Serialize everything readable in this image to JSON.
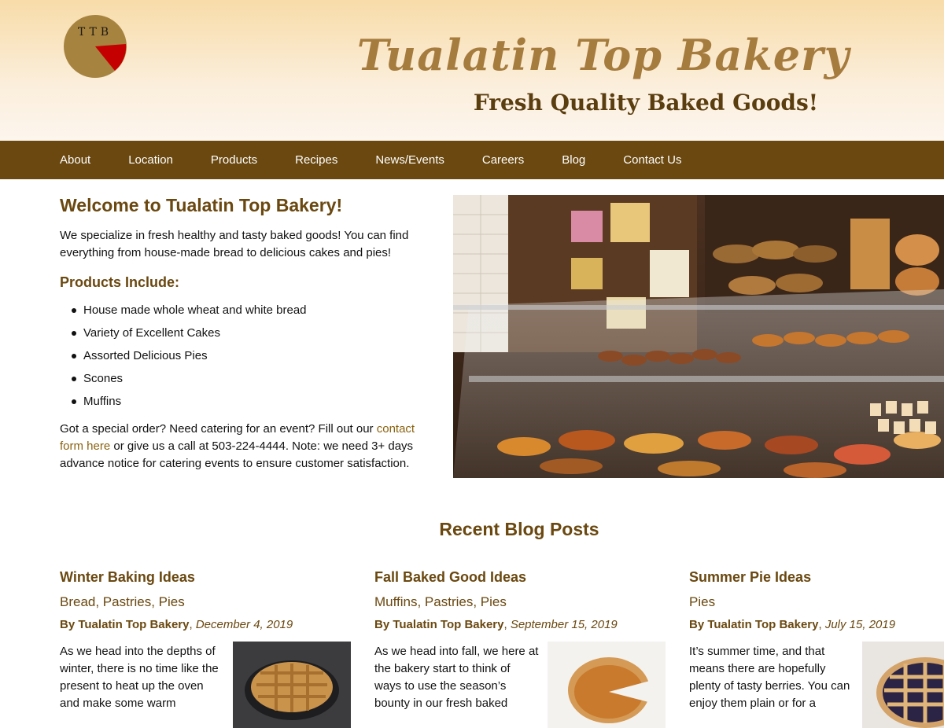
{
  "header": {
    "logo_text": "TTB",
    "site_title": "Tualatin Top Bakery",
    "tagline": "Fresh Quality Baked Goods!"
  },
  "nav": {
    "items": [
      "About",
      "Location",
      "Products",
      "Recipes",
      "News/Events",
      "Careers",
      "Blog",
      "Contact Us"
    ]
  },
  "intro": {
    "heading": "Welcome to Tualatin Top Bakery!",
    "paragraph": "We specialize in fresh healthy and tasty baked goods! You can find everything from house-made bread to delicious cakes and pies!",
    "products_heading": "Products Include:",
    "products": [
      "House made whole wheat and white bread",
      "Variety of Excellent Cakes",
      "Assorted Delicious Pies",
      "Scones",
      "Muffins"
    ],
    "order_text_before": "Got a special order? Need catering for an event? Fill out our ",
    "order_link": "contact form here",
    "order_text_after": " or give us a call at 503-224-4444. Note: we need 3+ days advance notice for catering events to ensure customer satisfaction."
  },
  "blog": {
    "heading": "Recent Blog Posts",
    "posts": [
      {
        "title": "Winter Baking Ideas",
        "categories": "Bread, Pastries, Pies",
        "author": "By Tualatin Top Bakery",
        "date": "December 4, 2019",
        "excerpt": "As we head into the depths of winter, there is no time like the present to heat up the oven and make some warm"
      },
      {
        "title": "Fall Baked Good Ideas",
        "categories": "Muffins, Pastries, Pies",
        "author": "By Tualatin Top Bakery",
        "date": "September 15, 2019",
        "excerpt": "As we head into fall, we here at the bakery start to think of ways to use the season’s bounty in our fresh baked"
      },
      {
        "title": "Summer Pie Ideas",
        "categories": "Pies",
        "author": "By Tualatin Top Bakery",
        "date": "July 15, 2019",
        "excerpt": "It’s summer time, and that means there are hopefully plenty of tasty berries. You can enjoy them plain or for a"
      }
    ]
  },
  "colors": {
    "brand_brown": "#6a4810",
    "title_gold": "#a57b3e",
    "logo_red": "#c40000"
  }
}
